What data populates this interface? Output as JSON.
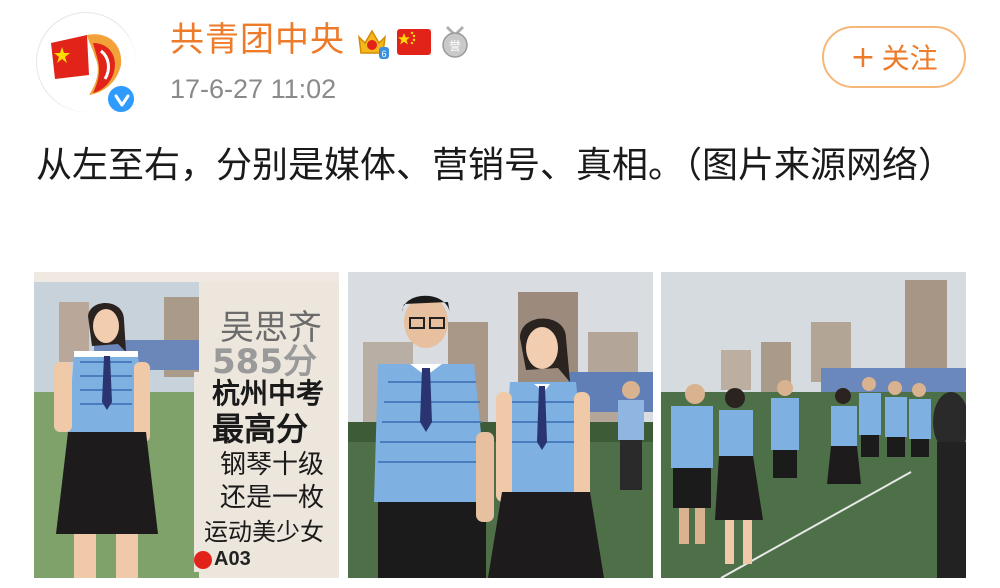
{
  "author": {
    "name": "共青团中央",
    "avatar_icon": "communist-youth-league-logo-icon",
    "verified_icon": "verified-badge-icon",
    "badges": [
      "crown-level-badge-icon",
      "china-flag-icon",
      "medal-badge-icon"
    ],
    "crown_level": "6"
  },
  "post": {
    "time": "17-6-27 11:02",
    "text": "从左至右，分别是媒体、营销号、真相。（图片来源网络）"
  },
  "follow_button": {
    "plus": "+",
    "label": "关注"
  },
  "photos": {
    "photo1": {
      "headline_name": "吴思齐",
      "headline_score": "585分",
      "headline_line1": "杭州中考",
      "headline_line2": "最高分",
      "headline_line3": "钢琴十级",
      "headline_line4": "还是一枚",
      "headline_line5": "运动美少女",
      "page_tag": "A03"
    }
  },
  "colors": {
    "accent_orange": "#ee7b2a",
    "follow_border": "#f6b778",
    "timestamp_gray": "#8a8a8a",
    "verified_blue": "#2f9bff",
    "uniform_blue": "#6fa3d8"
  }
}
